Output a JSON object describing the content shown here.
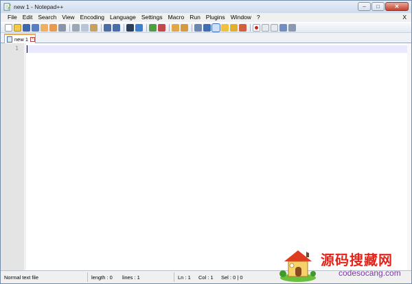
{
  "window": {
    "title": "new 1 - Notepad++",
    "controls": {
      "minimize": "–",
      "maximize": "□",
      "close": "✕"
    }
  },
  "menubar": {
    "items": [
      "File",
      "Edit",
      "Search",
      "View",
      "Encoding",
      "Language",
      "Settings",
      "Macro",
      "Run",
      "Plugins",
      "Window",
      "?"
    ],
    "close_label": "X"
  },
  "toolbar": {
    "icons": [
      "new-file-icon",
      "open-file-icon",
      "save-icon",
      "save-all-icon",
      "close-icon",
      "close-all-icon",
      "print-icon",
      "cut-icon",
      "copy-icon",
      "paste-icon",
      "undo-icon",
      "redo-icon",
      "find-icon",
      "replace-icon",
      "zoom-in-icon",
      "zoom-out-icon",
      "sync-vertical-icon",
      "sync-horizontal-icon",
      "word-wrap-icon",
      "show-all-chars-icon",
      "indent-guide-icon",
      "user-language-icon",
      "doc-map-icon",
      "function-list-icon",
      "record-macro-icon",
      "stop-record-icon",
      "play-macro-icon",
      "run-macro-multiple-icon",
      "save-macro-icon"
    ],
    "pressed": "indent-guide-icon"
  },
  "tabs": [
    {
      "label": "new 1",
      "icon": "document-icon",
      "close_glyph": "×"
    }
  ],
  "editor": {
    "line_numbers": [
      "1"
    ],
    "content": ""
  },
  "statusbar": {
    "file_type": "Normal text file",
    "length": "length : 0",
    "lines": "lines : 1",
    "ln": "Ln : 1",
    "col": "Col : 1",
    "sel": "Sel : 0 | 0"
  },
  "watermark": {
    "chinese": "源码搜藏网",
    "domain": "codesocang.com"
  },
  "colors": {
    "current_line": "#e8e8ff",
    "gutter": "#e4e4e4",
    "tab_accent": "#f5a742",
    "watermark_red": "#e2241b"
  }
}
